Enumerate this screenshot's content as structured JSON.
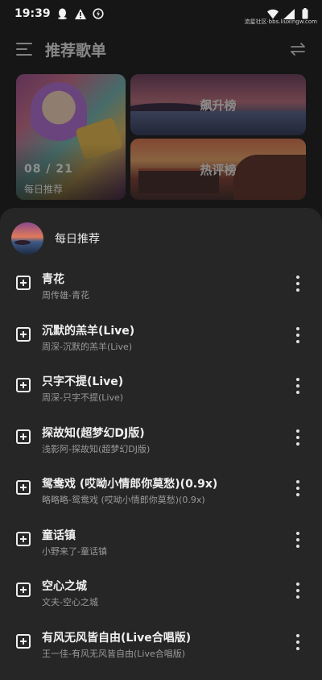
{
  "status_bar": {
    "time": "19:39",
    "watermark": "流星社区·bbs.liuxingw.com",
    "icons": [
      "qq-icon",
      "warning-icon",
      "data-saver-icon",
      "wifi-icon",
      "signal-icon",
      "battery-icon"
    ]
  },
  "header": {
    "title": "推荐歌单"
  },
  "cards": {
    "daily_date": "08 / 21",
    "daily_label": "每日推荐",
    "rise_label": "飙升榜",
    "hot_label": "热评榜"
  },
  "sheet": {
    "title": "每日推荐",
    "songs": [
      {
        "title": "青花",
        "subtitle": "周传雄-青花"
      },
      {
        "title": "沉默的羔羊(Live)",
        "subtitle": "周深-沉默的羔羊(Live)"
      },
      {
        "title": "只字不提(Live)",
        "subtitle": "周深-只字不提(Live)"
      },
      {
        "title": "探故知(超梦幻DJ版)",
        "subtitle": "浅影阿-探故知(超梦幻DJ版)"
      },
      {
        "title": "鸳鸯戏 (哎呦小情郎你莫愁)(0.9x)",
        "subtitle": "略略略-鸳鸯戏 (哎呦小情郎你莫愁)(0.9x)"
      },
      {
        "title": "童话镇",
        "subtitle": "小野来了-童话镇"
      },
      {
        "title": "空心之城",
        "subtitle": "文夫-空心之城"
      },
      {
        "title": "有风无风皆自由(Live合唱版)",
        "subtitle": "王一佳-有风无风皆自由(Live合唱版)"
      }
    ]
  },
  "colors": {
    "background": "#161616",
    "sheet": "#262626",
    "text_primary": "#f0f0f0",
    "text_secondary": "#9a9a9a"
  }
}
